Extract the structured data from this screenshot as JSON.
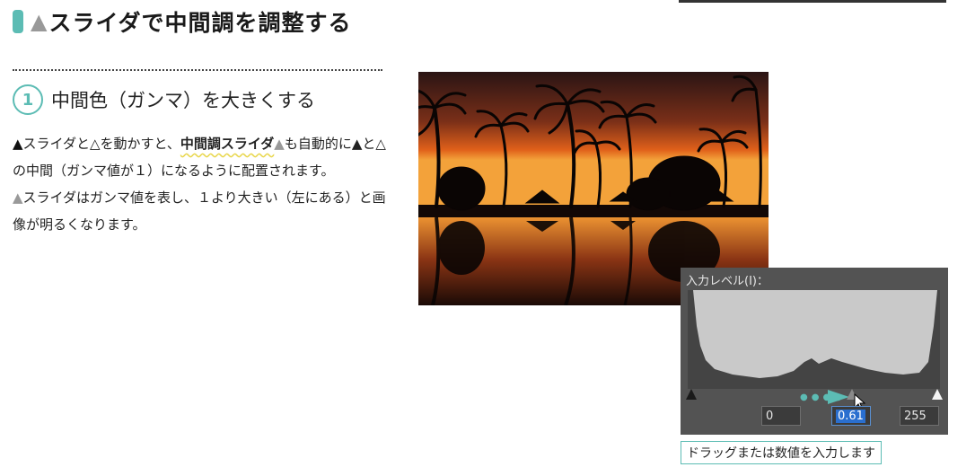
{
  "colors": {
    "accent": "#5cbcb4",
    "highlight": "#e8d64a"
  },
  "header": {
    "triangle": "▲",
    "title": "スライダで中間調を調整する"
  },
  "step": {
    "number": "1",
    "title": "中間色（ガンマ）を大きくする"
  },
  "body": {
    "p1": {
      "tri1": "▲",
      "t1": "スライダと△を動かすと、",
      "highlight": "中間調スライダ",
      "tri2": "▲",
      "t2": "も自動的に▲と△の中間（ガンマ値が１）になるように配置されます。"
    },
    "p2": {
      "tri": "▲",
      "text": "スライダはガンマ値を表し、１より大きい（左にある）と画像が明るくなります。"
    }
  },
  "levels": {
    "label": "入力レベル(I)：",
    "black_value": "0",
    "gamma_value": "0.61",
    "white_value": "255",
    "drag_dots": "●●●●"
  },
  "caption": "ドラッグまたは数値を入力します"
}
